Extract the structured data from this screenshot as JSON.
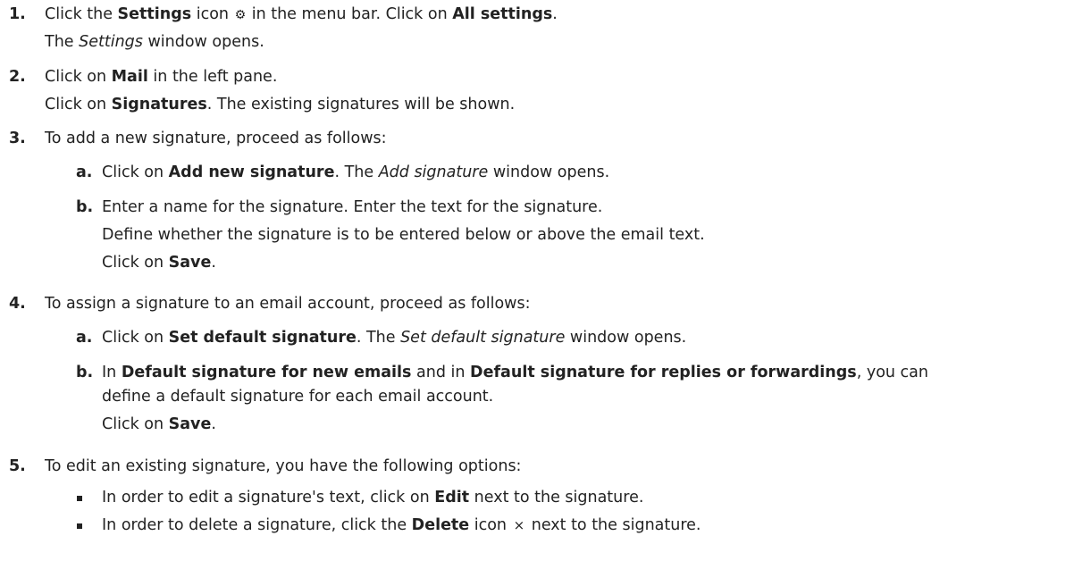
{
  "steps": {
    "s1": {
      "num": "1.",
      "l1": {
        "a": "Click the ",
        "b": "Settings",
        "c": " icon ",
        "icon": "⚙",
        "d": " in the menu bar. Click on ",
        "e": "All settings",
        "f": "."
      },
      "l2": {
        "a": "The ",
        "b": "Settings",
        "c": " window opens."
      }
    },
    "s2": {
      "num": "2.",
      "l1": {
        "a": "Click on ",
        "b": "Mail",
        "c": " in the left pane."
      },
      "l2": {
        "a": "Click on ",
        "b": "Signatures",
        "c": ". The existing signatures will be shown."
      }
    },
    "s3": {
      "num": "3.",
      "l1": "To add a new signature, proceed as follows:",
      "a": {
        "letter": "a.",
        "l1": {
          "a": "Click on ",
          "b": "Add new signature",
          "c": ". The ",
          "d": "Add signature",
          "e": " window opens."
        }
      },
      "b": {
        "letter": "b.",
        "l1": "Enter a name for the signature. Enter the text for the signature.",
        "l2": "Define whether the signature is to be entered below or above the email text.",
        "l3": {
          "a": "Click on ",
          "b": "Save",
          "c": "."
        }
      }
    },
    "s4": {
      "num": "4.",
      "l1": "To assign a signature to an email account, proceed as follows:",
      "a": {
        "letter": "a.",
        "l1": {
          "a": "Click on ",
          "b": "Set default signature",
          "c": ". The ",
          "d": "Set default signature",
          "e": " window opens."
        }
      },
      "b": {
        "letter": "b.",
        "l1": {
          "a": "In ",
          "b": "Default signature for new emails",
          "c": " and in ",
          "d": "Default signature for replies or forwardings",
          "e": ", you can"
        },
        "l2": "define a default signature for each email account.",
        "l3": {
          "a": "Click on ",
          "b": "Save",
          "c": "."
        }
      }
    },
    "s5": {
      "num": "5.",
      "l1": "To edit an existing signature, you have the following options:",
      "bul1": {
        "a": "In order to edit a signature's text, click on ",
        "b": "Edit",
        "c": " next to the signature."
      },
      "bul2": {
        "a": "In order to delete a signature, click the ",
        "b": "Delete",
        "c": " icon ",
        "icon": "×",
        "d": " next to the signature."
      }
    }
  },
  "icons": {
    "settings": "gear-icon",
    "delete": "close-icon"
  }
}
